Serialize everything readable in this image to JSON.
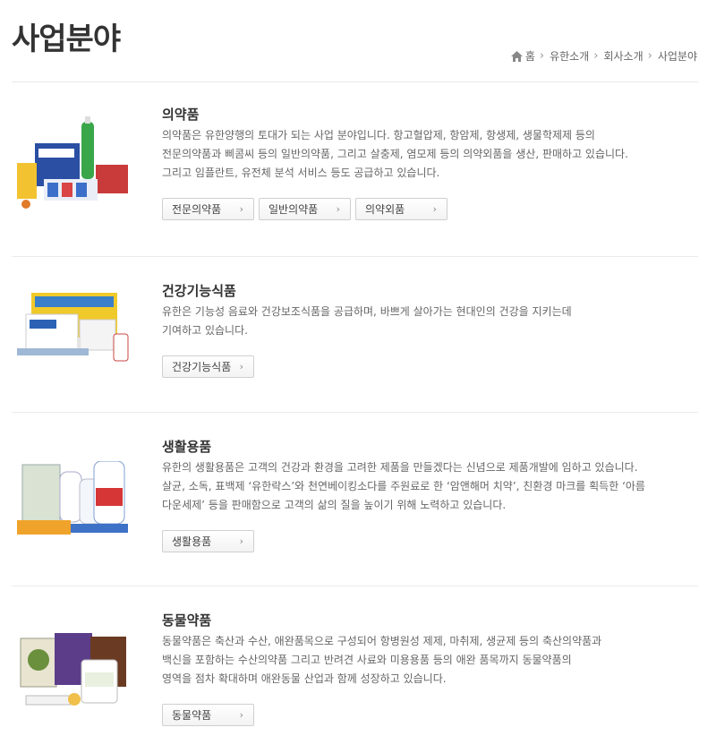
{
  "page": {
    "title": "사업분야"
  },
  "breadcrumb": [
    {
      "label": "홈",
      "icon": "home-icon"
    },
    {
      "label": "유한소개"
    },
    {
      "label": "회사소개"
    },
    {
      "label": "사업분야"
    }
  ],
  "sections": [
    {
      "title": "의약품",
      "description": [
        "의약품은 유한양행의 토대가 되는 사업 분야입니다. 항고혈압제, 항암제, 항생제, 생물학제제 등의",
        "전문의약품과 삐콤씨 등의 일반의약품, 그리고 살충제, 염모제 등의 의약외품을 생산, 판매하고 있습니다.",
        "그리고 임플란트, 유전체 분석 서비스 등도 공급하고 있습니다."
      ],
      "buttons": [
        "전문의약품",
        "일반의약품",
        "의약외품"
      ]
    },
    {
      "title": "건강기능식품",
      "description": [
        "유한은 기능성 음료와 건강보조식품을 공급하며, 바쁘게 살아가는 현대인의 건강을 지키는데",
        "기여하고 있습니다."
      ],
      "buttons": [
        "건강기능식품"
      ]
    },
    {
      "title": "생활용품",
      "description": [
        "유한의 생활용품은 고객의 건강과 환경을 고려한 제품을 만들겠다는 신념으로 제품개발에 임하고 있습니다.",
        "살균, 소독, 표백제 ‘유한락스’와 천연베이킹소다를 주원료로 한 ‘암앤해머 치약’, 친환경 마크를 획득한 ‘아름",
        "다운세제’ 등을 판매함으로 고객의 삶의 질을 높이기 위해 노력하고 있습니다."
      ],
      "buttons": [
        "생활용품"
      ]
    },
    {
      "title": "동물약품",
      "description": [
        "동물약품은 축산과 수산, 애완품목으로 구성되어 항병원성 제제, 마취제, 생균제 등의 축산의약품과",
        "백신을 포함하는 수산의약품 그리고 반려견 사료와 미용용품 등의 애완 품목까지 동물약품의",
        "영역을 점차 확대하며 애완동물 산업과 함께 성장하고 있습니다."
      ],
      "buttons": [
        "동물약품"
      ]
    }
  ]
}
